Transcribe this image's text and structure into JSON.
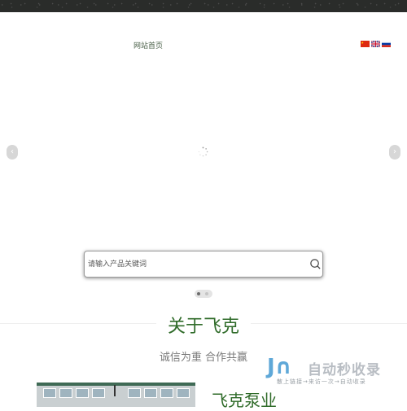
{
  "nav": {
    "home_label": "网站首页"
  },
  "languages": [
    {
      "name": "chinese-flag-icon"
    },
    {
      "name": "uk-flag-icon"
    },
    {
      "name": "russia-flag-icon"
    }
  ],
  "slider": {
    "prev_icon": "‹",
    "next_icon": "›",
    "active_slide": 1,
    "slide_count": 2
  },
  "search": {
    "placeholder": "请输入产品关键词",
    "value": ""
  },
  "about": {
    "title": "关于飞克",
    "subtitle": "诚信为重 合作共赢"
  },
  "company": {
    "name": "飞克泵业"
  },
  "watermark": {
    "logo": "J∩",
    "title": "自动秒收录",
    "tagline": "散上链接→来访一次→自动收录"
  },
  "colors": {
    "brand_green": "#2f6b29",
    "topbar": "#2a2c2a",
    "watermark_blue": "#5fa8d8"
  }
}
